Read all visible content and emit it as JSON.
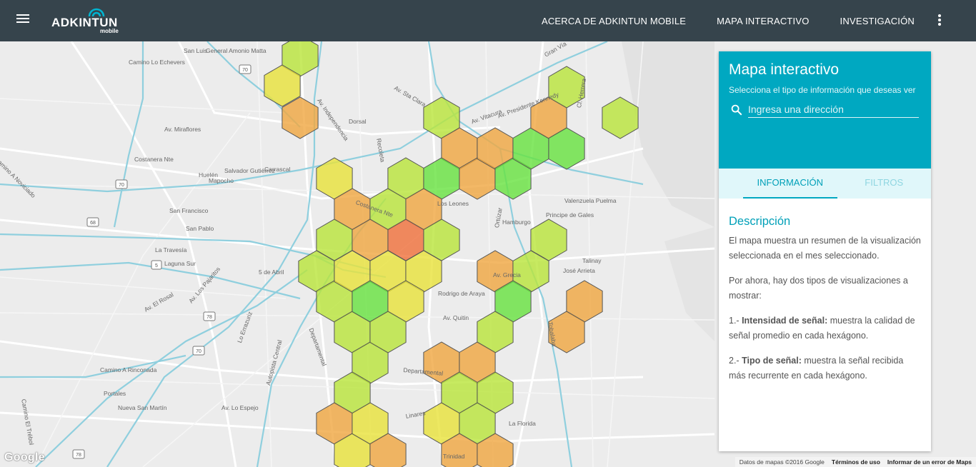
{
  "header": {
    "logo_text": "ADKINTUN",
    "logo_sub": "mobile",
    "nav": [
      "ACERCA DE ADKINTUN MOBILE",
      "MAPA INTERACTIVO",
      "INVESTIGACIÓN"
    ]
  },
  "panel": {
    "title": "Mapa interactivo",
    "subtitle": "Selecciona el tipo de información que deseas ver",
    "search_placeholder": "Ingresa una dirección",
    "tabs": [
      "INFORMACIÓN",
      "FILTROS"
    ],
    "description_title": "Descripción",
    "p1": "El mapa muestra un resumen de la visualización seleccionada en el mes seleccionado.",
    "p2": "Por ahora, hay dos tipos de visualizaciones a mostrar:",
    "p3_bold": "Intensidad de señal:",
    "p3_prefix": "1.- ",
    "p3_rest": " muestra la calidad de señal promedio en cada hexágono.",
    "p4_prefix": "2.- ",
    "p4_bold": "Tipo de señal:",
    "p4_rest": " muestra la señal recibida más recurrente en cada hexágono."
  },
  "map": {
    "google": "Google",
    "footer": [
      "Datos de mapas ©2016 Google",
      "Términos de uso",
      "Informar de un error de Maps"
    ],
    "labels": [
      "San Luis",
      "Camino Lo Echevers",
      "General Amonio Matta",
      "Camino A Noviciado",
      "Av. Miraflores",
      "Costanera Nte",
      "Salvador Gutiérrez",
      "Carrascal",
      "Huelén",
      "Mapocho",
      "San Francisco",
      "San Pablo",
      "La Travesía",
      "Laguna Sur",
      "5 de Abril",
      "Av. Los Pajaritos",
      "Av. El Rosal",
      "Camino A Rinconada",
      "Portales",
      "Nueva San Martín",
      "Av. Lo Espejo",
      "Autopista Central",
      "Departamental",
      "Rodrigo de Araya",
      "Av. Quitin",
      "Principe de Gales",
      "Valenzuela Puelma",
      "Talinay",
      "José Arrieta",
      "Tobalaba",
      "Av. Vitacura",
      "Av. Sta Clara",
      "Gran Vía",
      "Recoleta",
      "Dorsal",
      "Av. Independencia",
      "Av. Grecia",
      "Linares",
      "Trinidad",
      "La Florida",
      "Camino El Trébol",
      "Lo Errazuriz",
      "Av. Presidente Kennedy",
      "Los Leones",
      "Hamburgo",
      "Ortúzar",
      "Cl. Herrera",
      "Costanera Nte",
      "Departamental"
    ]
  },
  "colors": {
    "topbar": "#36444c",
    "accent": "#00a8c1",
    "hex_green": "#66e23e",
    "hex_yellowgreen": "#b9e53a",
    "hex_yellow": "#e8e23a",
    "hex_orange": "#f0a640",
    "hex_red": "#f06f3a"
  }
}
